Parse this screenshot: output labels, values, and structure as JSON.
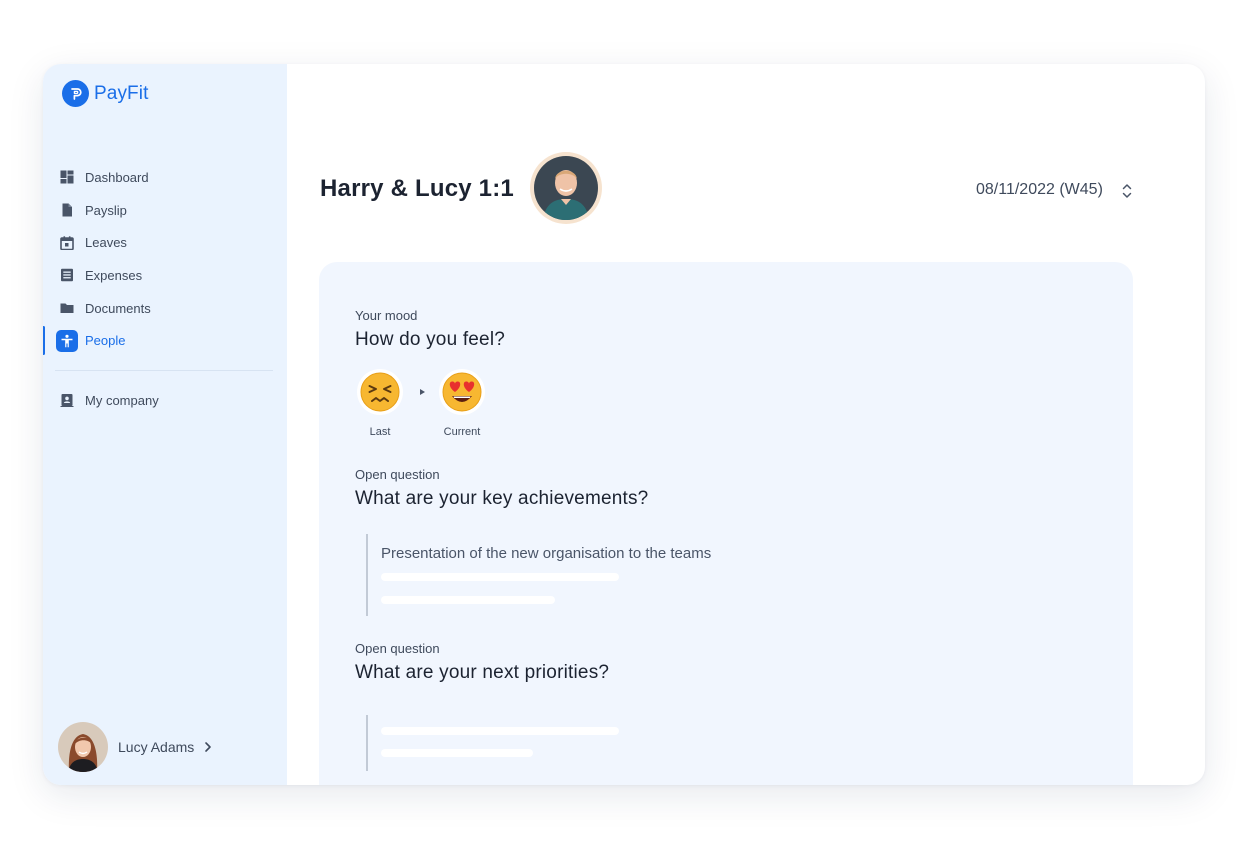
{
  "app": {
    "brand": "PayFit",
    "brand_color": "#1a6ee8"
  },
  "sidebar": {
    "items": [
      {
        "label": "Dashboard",
        "icon": "dashboard-icon"
      },
      {
        "label": "Payslip",
        "icon": "document-icon"
      },
      {
        "label": "Leaves",
        "icon": "calendar-icon"
      },
      {
        "label": "Expenses",
        "icon": "receipt-icon"
      },
      {
        "label": "Documents",
        "icon": "folder-icon"
      },
      {
        "label": "People",
        "icon": "person-icon",
        "active": true
      }
    ],
    "company": {
      "label": "My company",
      "icon": "company-badge-icon"
    },
    "user": {
      "name": "Lucy Adams"
    }
  },
  "header": {
    "title": "Harry & Lucy 1:1",
    "date": "08/11/2022 (W45)"
  },
  "mood_section": {
    "label": "Your mood",
    "question": "How do you feel?",
    "last": {
      "caption": "Last",
      "emoji": "😣"
    },
    "current": {
      "caption": "Current",
      "emoji": "😍"
    }
  },
  "achievements": {
    "label": "Open question",
    "question": "What are your key achievements?",
    "answer": "Presentation of the new organisation to the teams"
  },
  "priorities": {
    "label": "Open question",
    "question": "What are your next priorities?"
  }
}
